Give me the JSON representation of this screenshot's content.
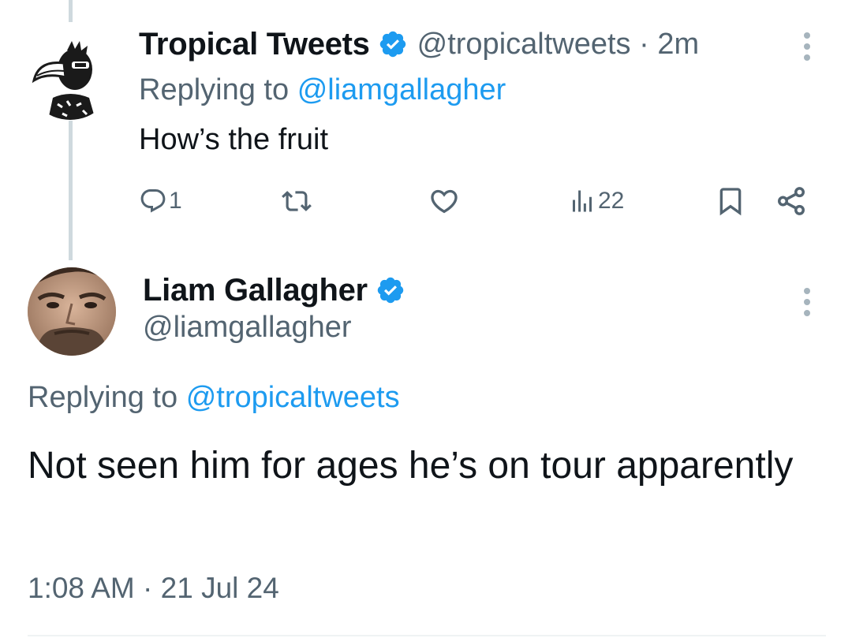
{
  "reply_tweet": {
    "author_name": "Tropical Tweets",
    "author_handle": "@tropicaltweets",
    "separator": "·",
    "time_ago": "2m",
    "replying_label": "Replying to",
    "replying_to": "@liamgallagher",
    "text": "How’s the fruit",
    "actions": {
      "reply_count": "1",
      "retweet_count": "",
      "like_count": "",
      "views_count": "22"
    }
  },
  "main_tweet": {
    "author_name": "Liam Gallagher",
    "author_handle": "@liamgallagher",
    "replying_label": "Replying to",
    "replying_to": "@tropicaltweets",
    "text": "Not seen him for ages he’s on tour apparently",
    "timestamp": "1:08 AM · 21 Jul 24"
  },
  "icons": [
    "verified-badge-icon",
    "more-options-icon",
    "reply-icon",
    "retweet-icon",
    "like-icon",
    "views-icon",
    "bookmark-icon",
    "share-icon"
  ],
  "colors": {
    "accent": "#1d9bf0",
    "secondary_text": "#536471",
    "primary_text": "#0f1419",
    "thread_line": "#cfd9de"
  }
}
